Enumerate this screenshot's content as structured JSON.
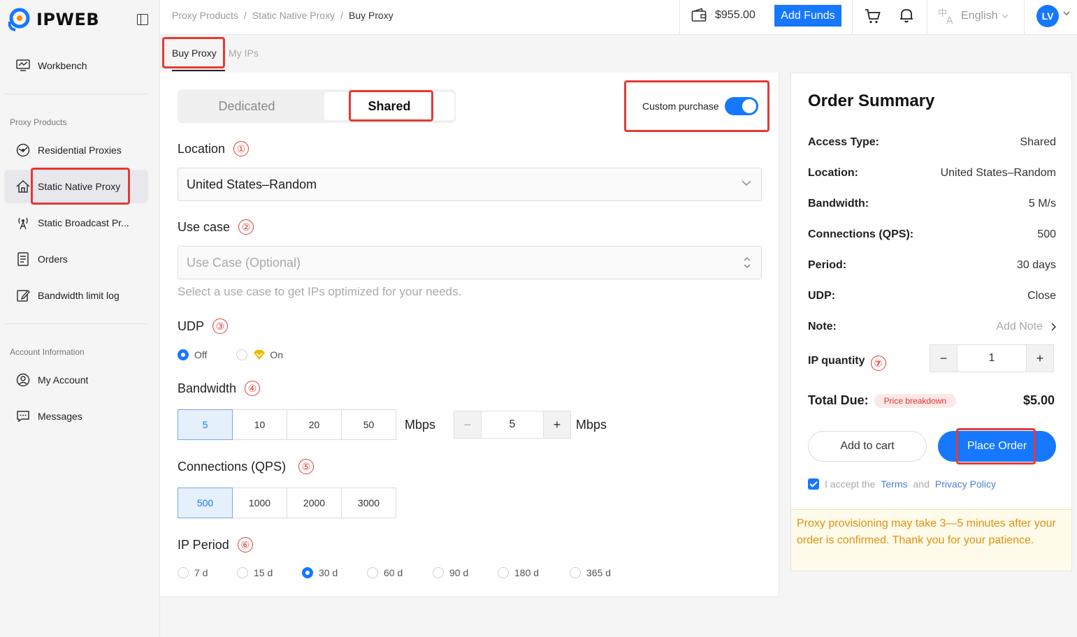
{
  "brand": {
    "name": "IPWEB"
  },
  "sidebar": {
    "workbench": "Workbench",
    "section_proxy": "Proxy Products",
    "items": [
      {
        "label": "Residential Proxies",
        "icon": "globe-icon"
      },
      {
        "label": "Static Native Proxy",
        "icon": "home-icon"
      },
      {
        "label": "Static Broadcast Pr...",
        "icon": "antenna-icon"
      },
      {
        "label": "Orders",
        "icon": "orders-icon"
      },
      {
        "label": "Bandwidth limit log",
        "icon": "edit-log-icon"
      }
    ],
    "section_account": "Account Information",
    "account_items": [
      {
        "label": "My Account",
        "icon": "user-icon"
      },
      {
        "label": "Messages",
        "icon": "message-icon"
      }
    ]
  },
  "header": {
    "breadcrumb": [
      "Proxy Products",
      "Static Native Proxy",
      "Buy Proxy"
    ],
    "separator": "/",
    "balance": "$955.00",
    "add_funds": "Add Funds",
    "language": "English",
    "avatar": "LV"
  },
  "tabs": [
    "Buy Proxy",
    "My IPs"
  ],
  "form": {
    "access_types": [
      "Dedicated",
      "Shared"
    ],
    "selected_access": "Shared",
    "custom_purchase_label": "Custom purchase",
    "custom_purchase_on": true,
    "location": {
      "label": "Location",
      "num": "①",
      "value": "United States–Random"
    },
    "use_case": {
      "label": "Use case",
      "num": "②",
      "placeholder": "Use Case (Optional)",
      "helper": "Select a use case to get IPs optimized for your needs."
    },
    "udp": {
      "label": "UDP",
      "num": "③",
      "options": [
        "Off",
        "On"
      ],
      "selected": "Off"
    },
    "bandwidth": {
      "label": "Bandwidth",
      "num": "④",
      "options": [
        "5",
        "10",
        "20",
        "50"
      ],
      "selected": "5",
      "unit": "Mbps",
      "custom_value": "5",
      "minus": "−",
      "plus": "+"
    },
    "connections": {
      "label": "Connections (QPS)",
      "num": "⑤",
      "options": [
        "500",
        "1000",
        "2000",
        "3000"
      ],
      "selected": "500"
    },
    "period": {
      "label": "IP Period",
      "num": "⑥",
      "options": [
        "7 d",
        "15 d",
        "30 d",
        "60 d",
        "90 d",
        "180 d",
        "365 d"
      ],
      "selected": "30 d"
    }
  },
  "summary": {
    "title": "Order Summary",
    "rows": [
      {
        "k": "Access Type:",
        "v": "Shared"
      },
      {
        "k": "Location:",
        "v": "United States–Random"
      },
      {
        "k": "Bandwidth:",
        "v": "5 M/s"
      },
      {
        "k": "Connections (QPS):",
        "v": "500"
      },
      {
        "k": "Period:",
        "v": "30 days"
      },
      {
        "k": "UDP:",
        "v": "Close"
      }
    ],
    "note_label": "Note:",
    "note_value": "Add Note",
    "ip_quantity_label": "IP quantity",
    "ip_quantity_num": "⑦",
    "ip_quantity": "1",
    "total_label": "Total Due:",
    "price_breakdown": "Price breakdown",
    "total_value": "$5.00",
    "add_to_cart": "Add to cart",
    "place_order": "Place Order",
    "accept_prefix": "I accept the",
    "terms": "Terms",
    "and": "and",
    "privacy": "Privacy Policy",
    "notice": "Proxy provisioning may take 3—5 minutes after your order is confirmed. Thank you for your patience."
  },
  "colors": {
    "accent": "#1677ff",
    "highlight": "#e53935",
    "notice_text": "#e0900e"
  }
}
